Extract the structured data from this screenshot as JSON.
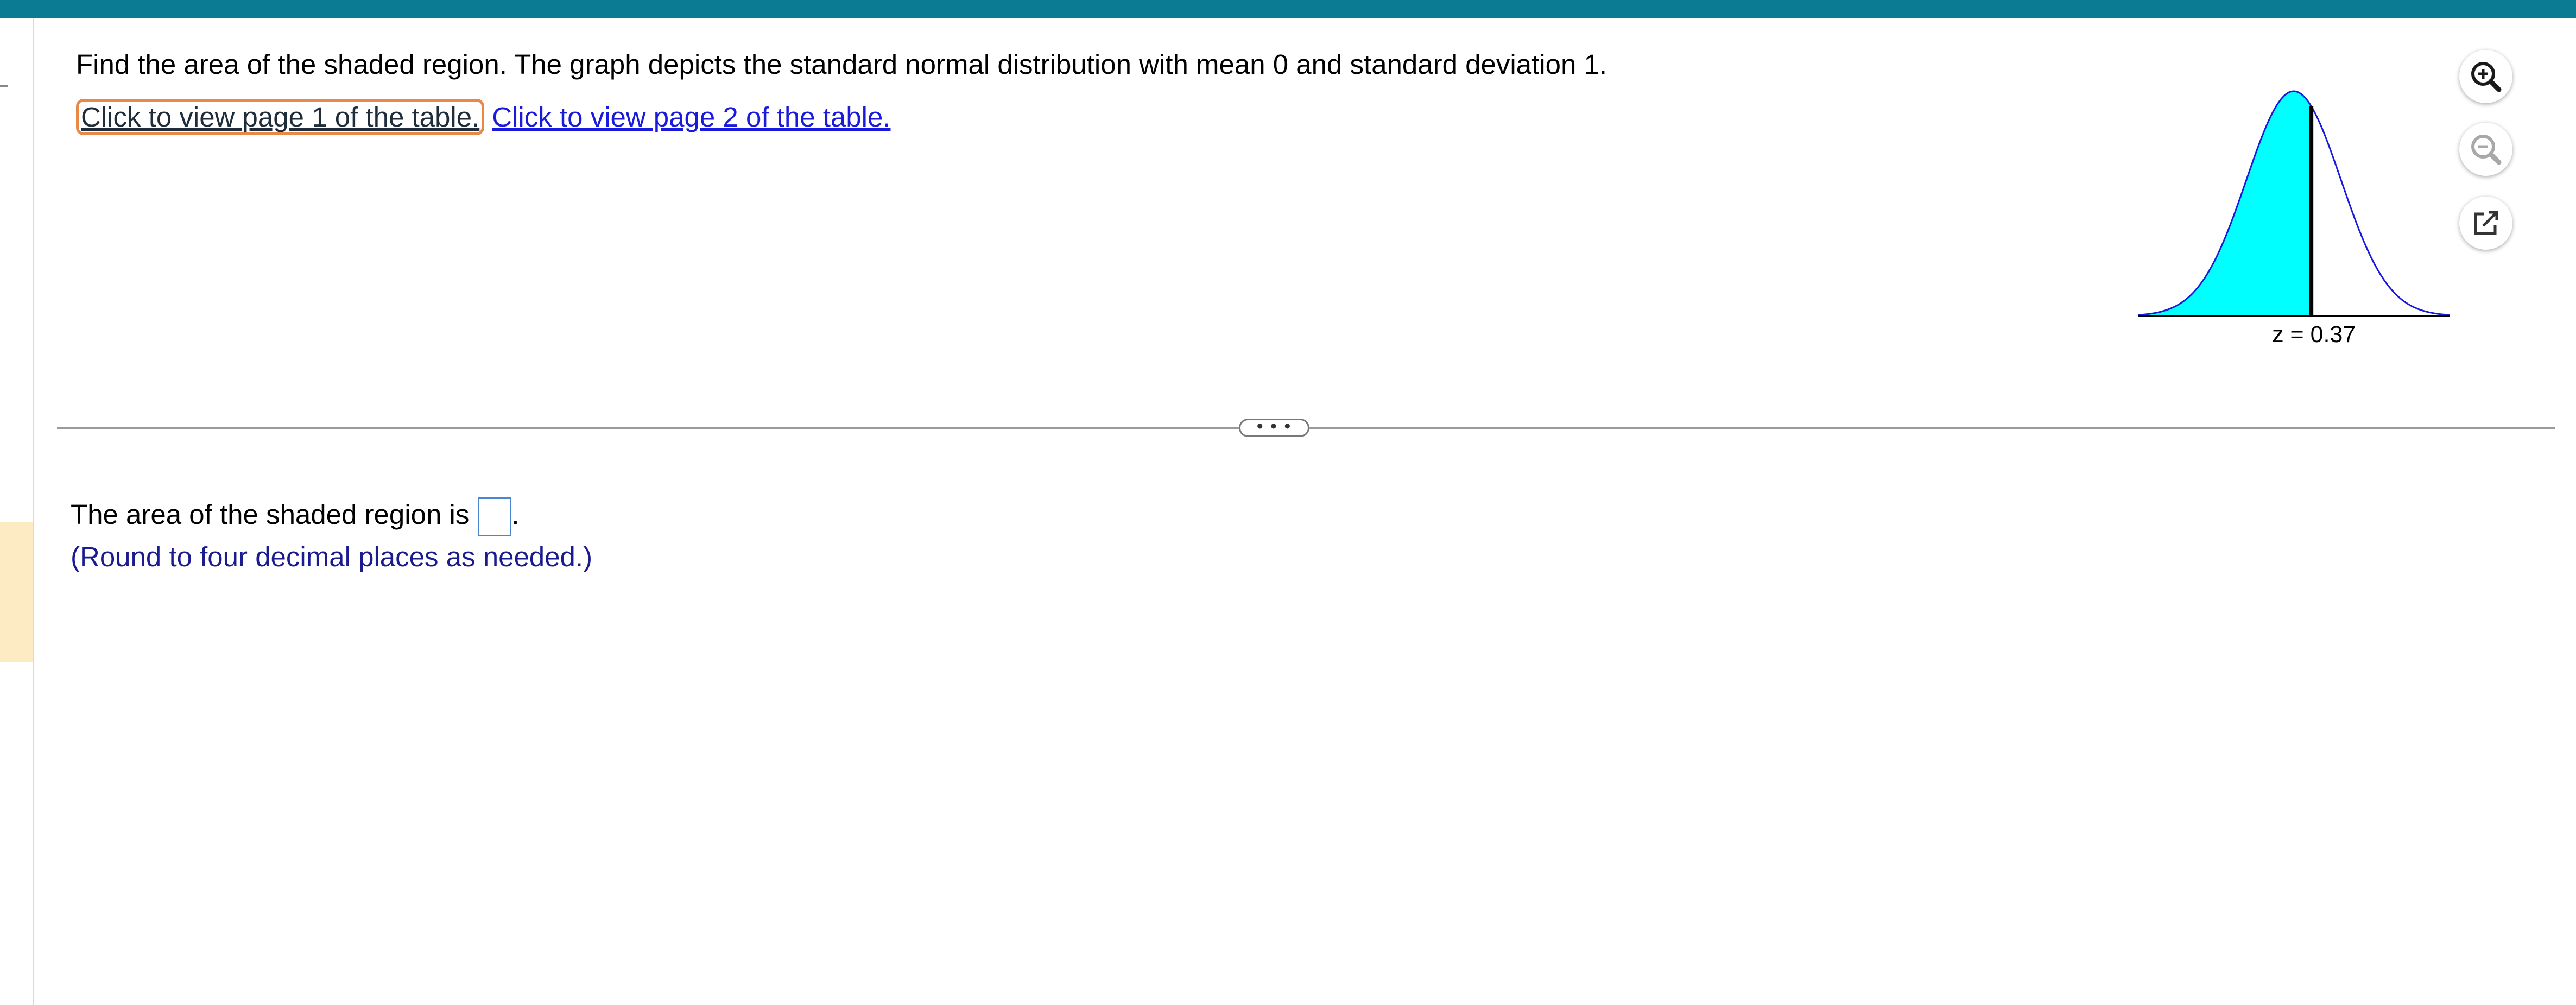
{
  "question": {
    "prompt": "Find the area of the shaded region. The graph depicts the standard normal distribution with mean 0 and standard deviation 1.",
    "link_page1": "Click to view page 1 of the table.",
    "link_page2": "Click to view page 2 of the table."
  },
  "graph": {
    "z_label": "z = 0.37",
    "z_value": 0.37,
    "shaded_side": "left",
    "shade_color": "#00ffff",
    "curve_color": "#1a1adc"
  },
  "toolbar": {
    "zoom_in_icon": "zoom-in-icon",
    "zoom_out_icon": "zoom-out-icon",
    "popout_icon": "external-link-icon"
  },
  "divider": {
    "handle_text": "• • •"
  },
  "answer": {
    "prefix": "The area of the shaded region is",
    "suffix": ".",
    "value": "",
    "hint": "(Round to four decimal places as needed.)"
  },
  "colors": {
    "top_bar": "#0a7b93",
    "link": "#1a1adc",
    "focus_ring": "#e8894a",
    "hint": "#1b1b8f"
  }
}
